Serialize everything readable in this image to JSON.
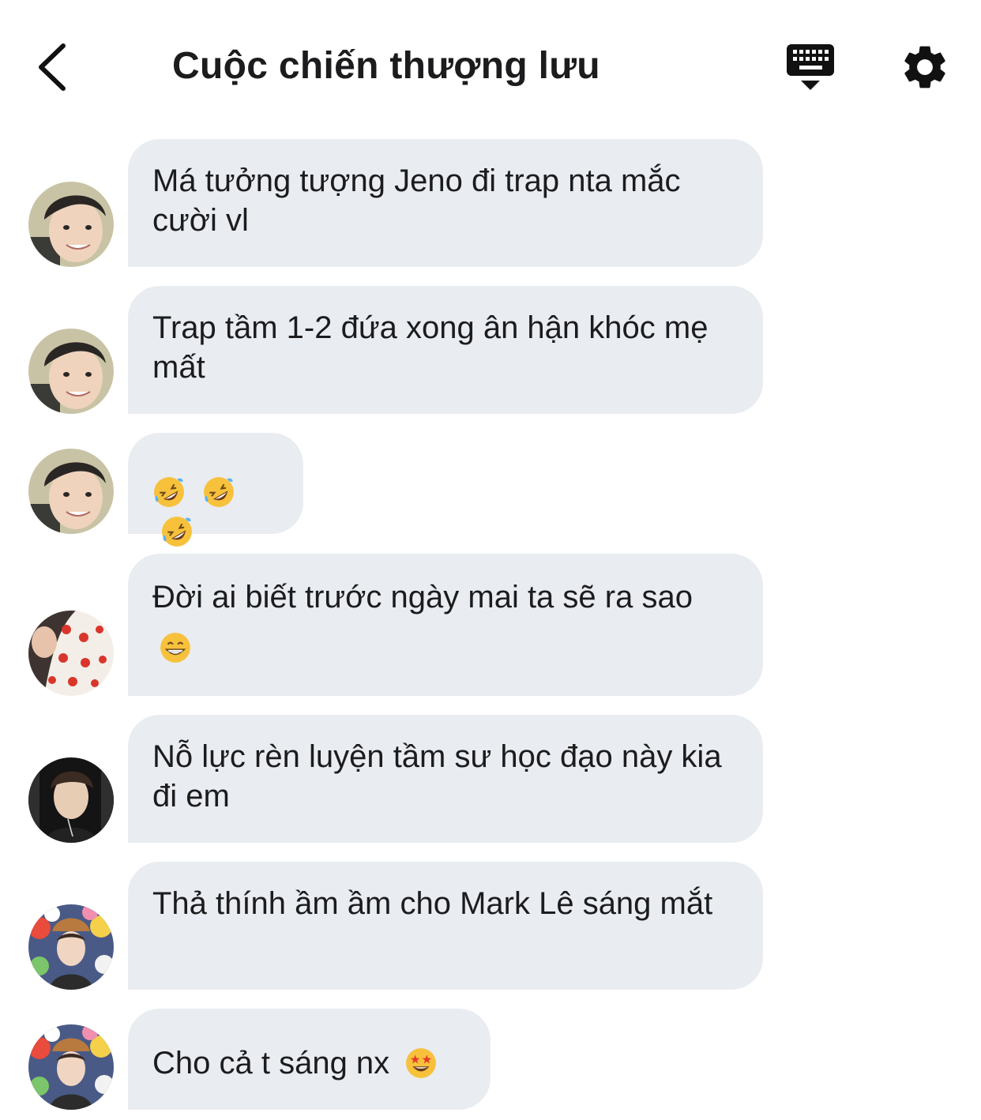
{
  "header": {
    "title": "Cuộc chiến thượng lưu",
    "back_icon": "chevron-left-icon",
    "keyboard_icon": "keyboard-hide-icon",
    "settings_icon": "gear-icon"
  },
  "colors": {
    "bubble_background": "#e9ecf0",
    "text": "#1c1c1e",
    "emoji_face": "#f7c13c"
  },
  "messages": [
    {
      "text": "Má tưởng tượng Jeno đi trap nta mắc cười vl",
      "avatar": "avatar-boy-portrait"
    },
    {
      "text": "Trap tầm 1-2 đứa xong ân hận khóc mẹ mất",
      "avatar": "avatar-boy-portrait"
    },
    {
      "text": "",
      "emoji": [
        "rolling-on-floor-laughing-emoji",
        "rolling-on-floor-laughing-emoji",
        "rolling-on-floor-laughing-emoji"
      ],
      "avatar": "avatar-boy-portrait"
    },
    {
      "text": "Đời ai biết trước ngày mai ta sẽ ra sao",
      "emoji": [
        "grinning-face-emoji"
      ],
      "avatar": "avatar-strawberries"
    },
    {
      "text": "Nỗ lực rèn luyện tầm sư học đạo này kia đi em",
      "avatar": "avatar-dark-selfie"
    },
    {
      "text": "Thả thính ầm ầm cho Mark Lê sáng mắt",
      "avatar": "avatar-plush-toys"
    },
    {
      "text": "Cho cả t sáng nx",
      "emoji": [
        "star-struck-emoji"
      ],
      "avatar": "avatar-plush-toys"
    }
  ]
}
